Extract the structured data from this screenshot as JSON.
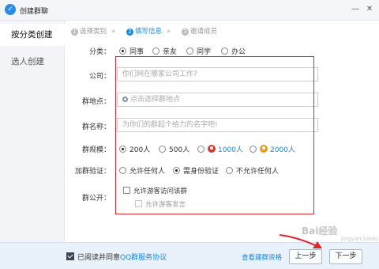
{
  "window": {
    "title": "创建群聊",
    "logo_glyph": "✓",
    "min_glyph": "—",
    "close_glyph": "✕"
  },
  "sidebar": {
    "items": [
      {
        "label": "按分类创建"
      },
      {
        "label": "选人创建"
      }
    ]
  },
  "steps": [
    {
      "num": "1",
      "label": "选择类别",
      "arrow": "»"
    },
    {
      "num": "2",
      "label": "填写信息",
      "arrow": "»"
    },
    {
      "num": "3",
      "label": "邀请成员"
    }
  ],
  "form": {
    "category": {
      "label": "分类：",
      "options": [
        "同事",
        "亲友",
        "同学",
        "办公"
      ],
      "selected": "同事"
    },
    "company": {
      "label": "公司：",
      "placeholder": "你们网在哪家公司工作?"
    },
    "location": {
      "label": "群地点：",
      "placeholder": "点击选择群地点"
    },
    "name": {
      "label": "群名称：",
      "placeholder": "为你们的群起个给力的名字吧!"
    },
    "size": {
      "label": "群规模：",
      "options": [
        "200人",
        "500人",
        "1000人",
        "2000人"
      ],
      "selected": "200人"
    },
    "verify": {
      "label": "加群验证：",
      "options": [
        "允许任何人",
        "需身份验证",
        "不允许任何人"
      ],
      "selected": "需身份验证"
    },
    "public": {
      "label": "群公开：",
      "visitor_access": "允许游客访问该群",
      "visitor_speak": "允许游客发言"
    }
  },
  "footer": {
    "agree_prefix": "已阅读并同意",
    "agree_link": "QQ群服务协议",
    "qualify_link": "查看建群资格",
    "prev_label": "上一步",
    "next_label": "下一步"
  },
  "watermark": {
    "text": "Bai经验",
    "sub": "jingyan.baidu.com"
  },
  "colors": {
    "accent": "#1c86d9",
    "highlight": "#e0262c"
  }
}
